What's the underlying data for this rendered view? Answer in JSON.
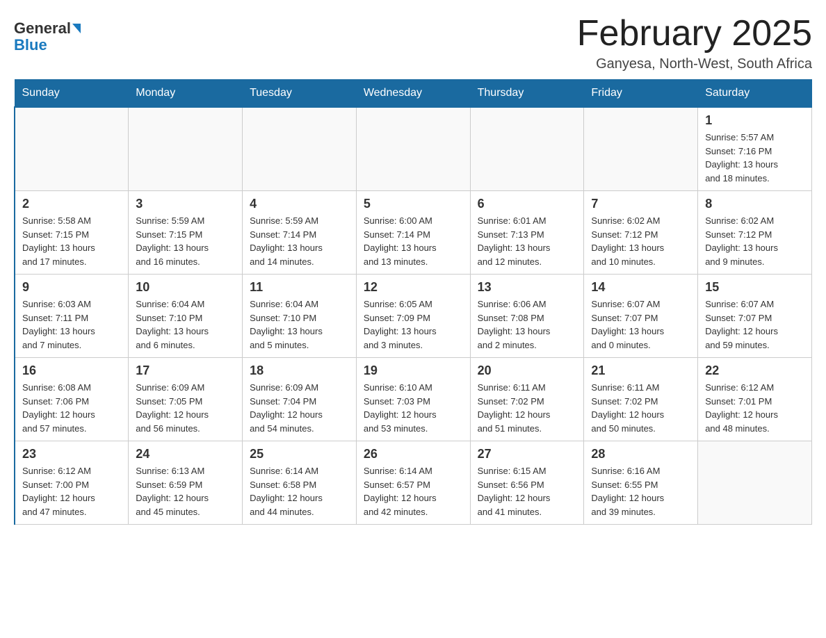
{
  "header": {
    "logo_general": "General",
    "logo_blue": "Blue",
    "month_title": "February 2025",
    "location": "Ganyesa, North-West, South Africa"
  },
  "weekdays": [
    "Sunday",
    "Monday",
    "Tuesday",
    "Wednesday",
    "Thursday",
    "Friday",
    "Saturday"
  ],
  "weeks": [
    [
      {
        "day": "",
        "info": ""
      },
      {
        "day": "",
        "info": ""
      },
      {
        "day": "",
        "info": ""
      },
      {
        "day": "",
        "info": ""
      },
      {
        "day": "",
        "info": ""
      },
      {
        "day": "",
        "info": ""
      },
      {
        "day": "1",
        "info": "Sunrise: 5:57 AM\nSunset: 7:16 PM\nDaylight: 13 hours\nand 18 minutes."
      }
    ],
    [
      {
        "day": "2",
        "info": "Sunrise: 5:58 AM\nSunset: 7:15 PM\nDaylight: 13 hours\nand 17 minutes."
      },
      {
        "day": "3",
        "info": "Sunrise: 5:59 AM\nSunset: 7:15 PM\nDaylight: 13 hours\nand 16 minutes."
      },
      {
        "day": "4",
        "info": "Sunrise: 5:59 AM\nSunset: 7:14 PM\nDaylight: 13 hours\nand 14 minutes."
      },
      {
        "day": "5",
        "info": "Sunrise: 6:00 AM\nSunset: 7:14 PM\nDaylight: 13 hours\nand 13 minutes."
      },
      {
        "day": "6",
        "info": "Sunrise: 6:01 AM\nSunset: 7:13 PM\nDaylight: 13 hours\nand 12 minutes."
      },
      {
        "day": "7",
        "info": "Sunrise: 6:02 AM\nSunset: 7:12 PM\nDaylight: 13 hours\nand 10 minutes."
      },
      {
        "day": "8",
        "info": "Sunrise: 6:02 AM\nSunset: 7:12 PM\nDaylight: 13 hours\nand 9 minutes."
      }
    ],
    [
      {
        "day": "9",
        "info": "Sunrise: 6:03 AM\nSunset: 7:11 PM\nDaylight: 13 hours\nand 7 minutes."
      },
      {
        "day": "10",
        "info": "Sunrise: 6:04 AM\nSunset: 7:10 PM\nDaylight: 13 hours\nand 6 minutes."
      },
      {
        "day": "11",
        "info": "Sunrise: 6:04 AM\nSunset: 7:10 PM\nDaylight: 13 hours\nand 5 minutes."
      },
      {
        "day": "12",
        "info": "Sunrise: 6:05 AM\nSunset: 7:09 PM\nDaylight: 13 hours\nand 3 minutes."
      },
      {
        "day": "13",
        "info": "Sunrise: 6:06 AM\nSunset: 7:08 PM\nDaylight: 13 hours\nand 2 minutes."
      },
      {
        "day": "14",
        "info": "Sunrise: 6:07 AM\nSunset: 7:07 PM\nDaylight: 13 hours\nand 0 minutes."
      },
      {
        "day": "15",
        "info": "Sunrise: 6:07 AM\nSunset: 7:07 PM\nDaylight: 12 hours\nand 59 minutes."
      }
    ],
    [
      {
        "day": "16",
        "info": "Sunrise: 6:08 AM\nSunset: 7:06 PM\nDaylight: 12 hours\nand 57 minutes."
      },
      {
        "day": "17",
        "info": "Sunrise: 6:09 AM\nSunset: 7:05 PM\nDaylight: 12 hours\nand 56 minutes."
      },
      {
        "day": "18",
        "info": "Sunrise: 6:09 AM\nSunset: 7:04 PM\nDaylight: 12 hours\nand 54 minutes."
      },
      {
        "day": "19",
        "info": "Sunrise: 6:10 AM\nSunset: 7:03 PM\nDaylight: 12 hours\nand 53 minutes."
      },
      {
        "day": "20",
        "info": "Sunrise: 6:11 AM\nSunset: 7:02 PM\nDaylight: 12 hours\nand 51 minutes."
      },
      {
        "day": "21",
        "info": "Sunrise: 6:11 AM\nSunset: 7:02 PM\nDaylight: 12 hours\nand 50 minutes."
      },
      {
        "day": "22",
        "info": "Sunrise: 6:12 AM\nSunset: 7:01 PM\nDaylight: 12 hours\nand 48 minutes."
      }
    ],
    [
      {
        "day": "23",
        "info": "Sunrise: 6:12 AM\nSunset: 7:00 PM\nDaylight: 12 hours\nand 47 minutes."
      },
      {
        "day": "24",
        "info": "Sunrise: 6:13 AM\nSunset: 6:59 PM\nDaylight: 12 hours\nand 45 minutes."
      },
      {
        "day": "25",
        "info": "Sunrise: 6:14 AM\nSunset: 6:58 PM\nDaylight: 12 hours\nand 44 minutes."
      },
      {
        "day": "26",
        "info": "Sunrise: 6:14 AM\nSunset: 6:57 PM\nDaylight: 12 hours\nand 42 minutes."
      },
      {
        "day": "27",
        "info": "Sunrise: 6:15 AM\nSunset: 6:56 PM\nDaylight: 12 hours\nand 41 minutes."
      },
      {
        "day": "28",
        "info": "Sunrise: 6:16 AM\nSunset: 6:55 PM\nDaylight: 12 hours\nand 39 minutes."
      },
      {
        "day": "",
        "info": ""
      }
    ]
  ]
}
